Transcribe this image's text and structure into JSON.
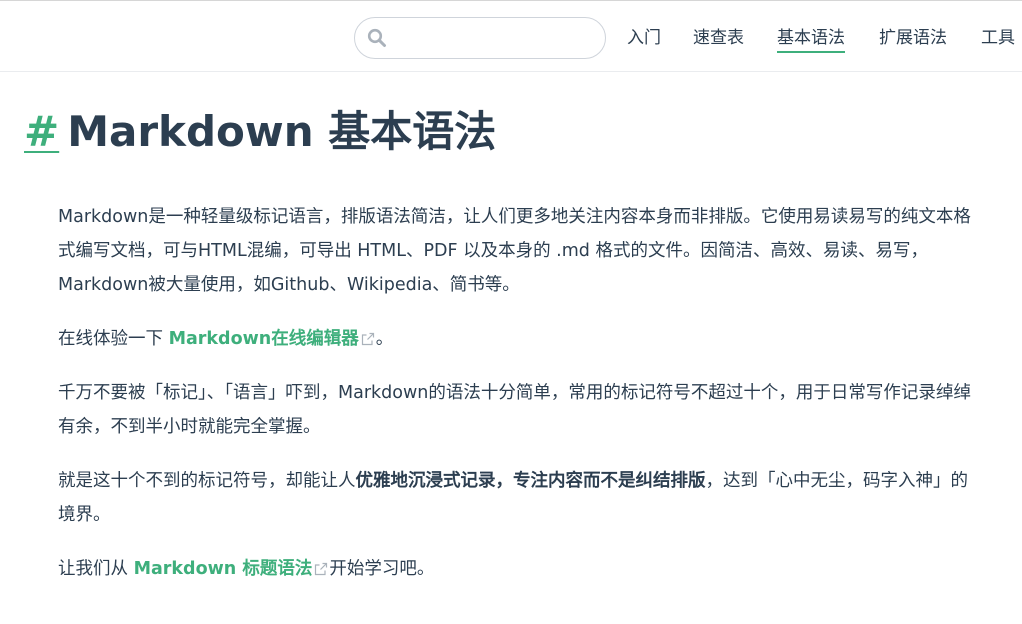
{
  "navbar": {
    "search": {
      "placeholder": "",
      "value": ""
    },
    "items": [
      {
        "label": "入门",
        "active": false
      },
      {
        "label": "速查表",
        "active": false
      },
      {
        "label": "基本语法",
        "active": true
      },
      {
        "label": "扩展语法",
        "active": false
      },
      {
        "label": "工具",
        "active": false
      }
    ],
    "accent_color": "#3eaf7c"
  },
  "page": {
    "anchor": "#",
    "title": "Markdown 基本语法",
    "paragraphs": {
      "p1": "Markdown是一种轻量级标记语言，排版语法简洁，让人们更多地关注内容本身而非排版。它使用易读易写的纯文本格式编写文档，可与HTML混编，可导出 HTML、PDF 以及本身的 .md 格式的文件。因简洁、高效、易读、易写，Markdown被大量使用，如Github、Wikipedia、简书等。",
      "p2": {
        "before": "在线体验一下 ",
        "link": "Markdown在线编辑器",
        "after": "。"
      },
      "p3": "千万不要被「标记」、「语言」吓到，Markdown的语法十分简单，常用的标记符号不超过十个，用于日常写作记录绰绰有余，不到半小时就能完全掌握。",
      "p4": {
        "before": "就是这十个不到的标记符号，却能让人",
        "strong": "优雅地沉浸式记录，专注内容而不是纠结排版",
        "after": "，达到「心中无尘，码字入神」的境界。"
      },
      "p5": {
        "before": "让我们从 ",
        "link": "Markdown 标题语法",
        "after": "开始学习吧。"
      }
    }
  }
}
